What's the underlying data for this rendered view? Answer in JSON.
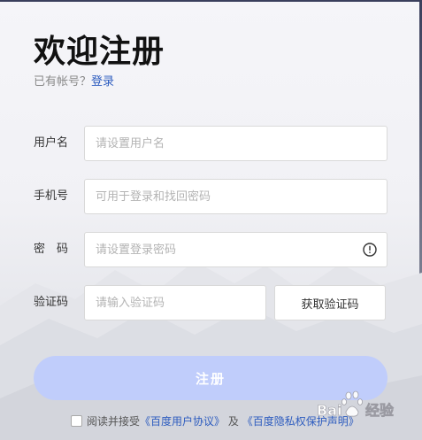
{
  "page": {
    "title": "欢迎注册",
    "login_prompt": "已有帐号？",
    "login_link": "登录"
  },
  "form": {
    "username": {
      "label": "用户名",
      "placeholder": "请设置用户名"
    },
    "phone": {
      "label": "手机号",
      "placeholder": "可用于登录和找回密码"
    },
    "password": {
      "label": "密　码",
      "placeholder": "请设置登录密码"
    },
    "verify_code": {
      "label": "验证码",
      "placeholder": "请输入验证码",
      "button": "获取验证码"
    }
  },
  "submit_label": "注册",
  "agreement": {
    "prefix": "阅读并接受",
    "link1": "《百度用户协议》",
    "connector": "及",
    "link2": "《百度隐私权保护声明》"
  },
  "watermark": {
    "logo_text": "Bai 经验"
  },
  "colors": {
    "link": "#2d5cbf",
    "submit_bg": "#c0cdfb",
    "field_border": "#d9d9d9"
  },
  "icons": {
    "password_hint": "info-circle-icon"
  }
}
